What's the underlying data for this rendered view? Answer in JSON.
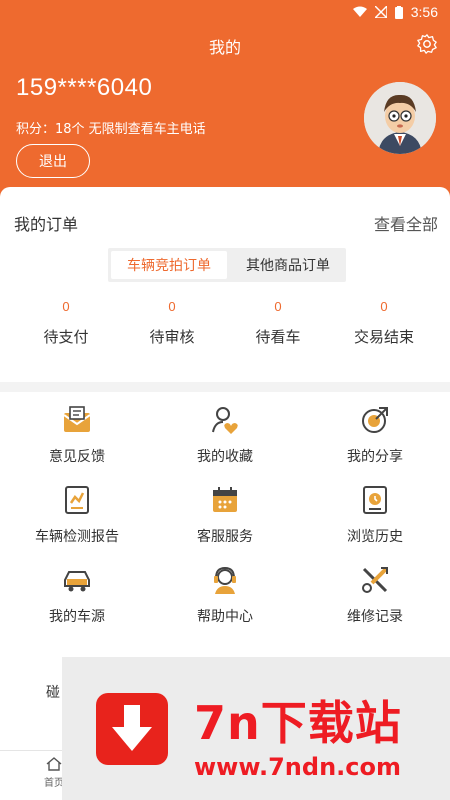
{
  "status": {
    "time": "3:56"
  },
  "header": {
    "title": "我的",
    "phone": "159****6040",
    "points": "积分：18个 无限制查看车主电话",
    "logout": "退出"
  },
  "orders": {
    "title": "我的订单",
    "view_all": "查看全部",
    "tabs": [
      "车辆竞拍订单",
      "其他商品订单"
    ],
    "stats": [
      {
        "count": "0",
        "label": "待支付"
      },
      {
        "count": "0",
        "label": "待审核"
      },
      {
        "count": "0",
        "label": "待看车"
      },
      {
        "count": "0",
        "label": "交易结束"
      }
    ]
  },
  "menu": [
    {
      "label": "意见反馈",
      "icon": "feedback-icon"
    },
    {
      "label": "我的收藏",
      "icon": "favorites-icon"
    },
    {
      "label": "我的分享",
      "icon": "share-icon"
    },
    {
      "label": "车辆检测报告",
      "icon": "report-icon"
    },
    {
      "label": "客服服务",
      "icon": "customer-service-icon"
    },
    {
      "label": "浏览历史",
      "icon": "history-icon"
    },
    {
      "label": "我的车源",
      "icon": "car-icon"
    },
    {
      "label": "帮助中心",
      "icon": "help-icon"
    },
    {
      "label": "维修记录",
      "icon": "repair-icon"
    }
  ],
  "menu_partial": {
    "label_start": "碰",
    "tab_home": "首页"
  },
  "overlay": {
    "brand": "7n下载站",
    "url": "www.7ndn.com"
  },
  "colors": {
    "accent": "#ee6a2f",
    "icon": "#e8a33a",
    "ad_red": "#ee1c23"
  }
}
